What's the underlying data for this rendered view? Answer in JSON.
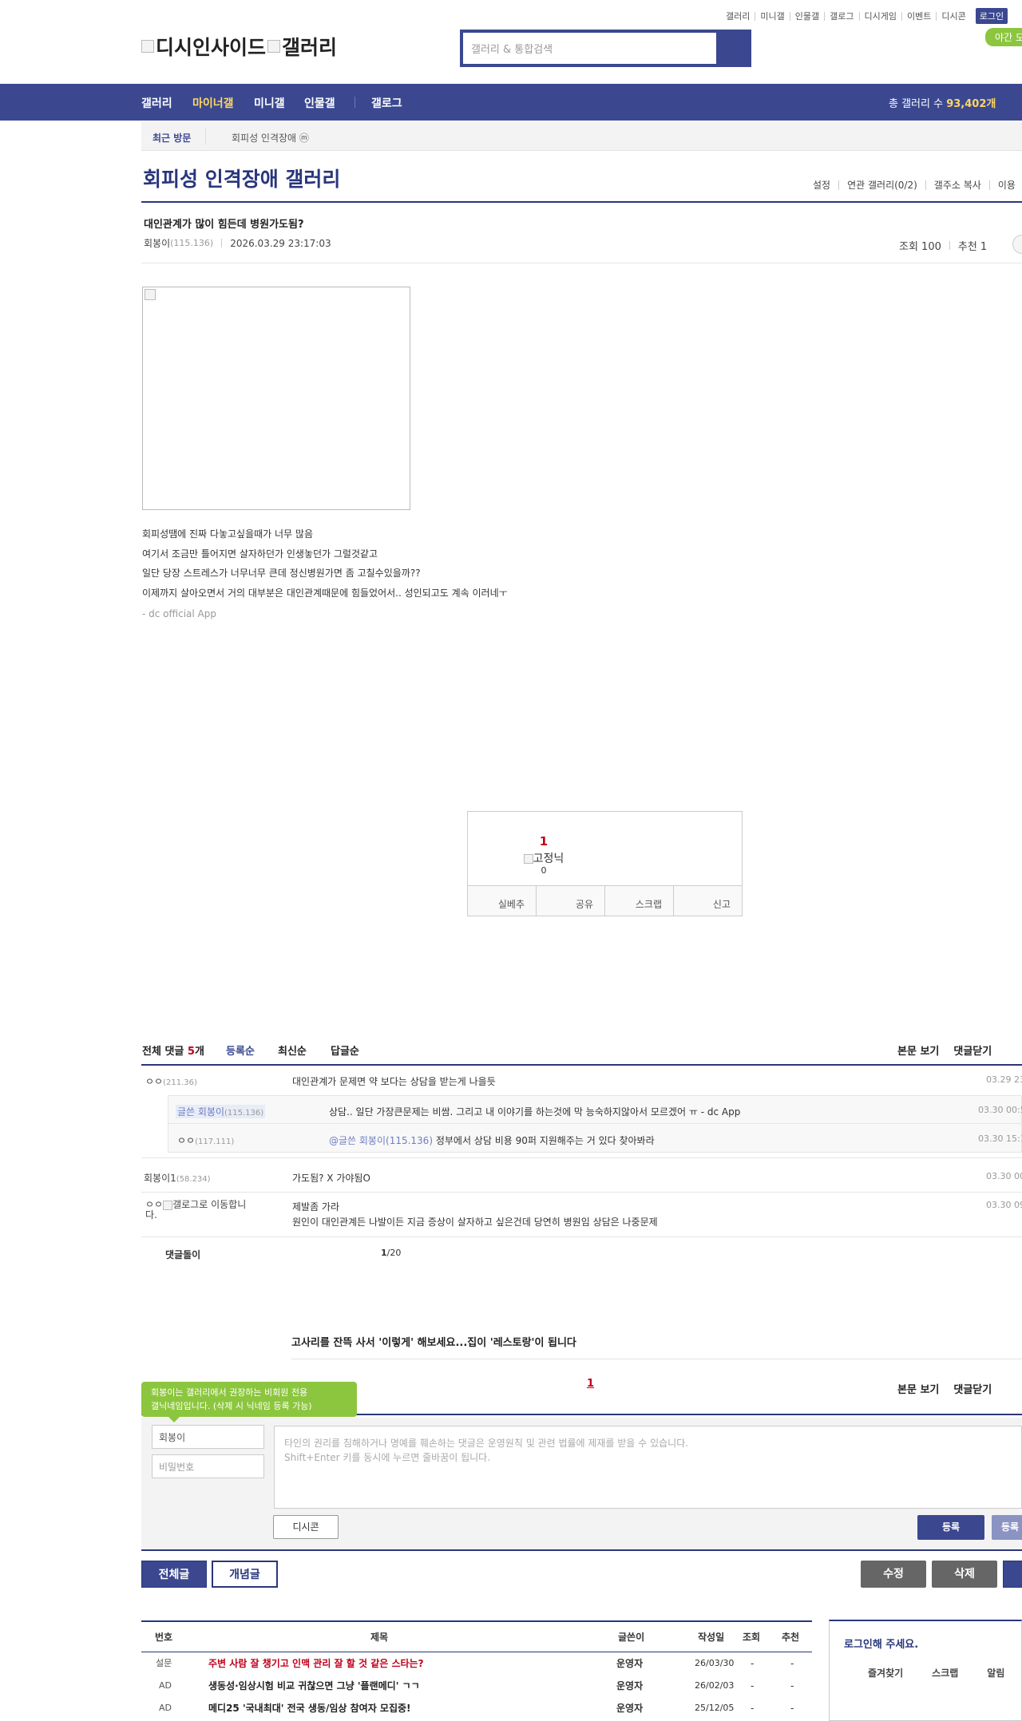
{
  "top_links": [
    "갤러리",
    "미니갤",
    "인물갤",
    "갤로그",
    "디시게임",
    "이벤트",
    "디시콘"
  ],
  "login_label": "로그인",
  "night_label": "야간 모",
  "logo": {
    "part1": "디시인사이드",
    "part2": "갤러리"
  },
  "search": {
    "placeholder": "갤러리 & 통합검색"
  },
  "nav": {
    "items": [
      "갤러리",
      "마이너갤",
      "미니갤",
      "인물갤",
      "갤로그"
    ],
    "total_label": "총 갤러리 수 ",
    "total_value": "93,402개"
  },
  "recent": {
    "label": "최근 방문",
    "item": "회피성 인격장애 ⓜ"
  },
  "gallery": {
    "title": "회피성 인격장애 갤러리",
    "tools": [
      "설정",
      "연관 갤러리(0/2)",
      "갤주소 복사",
      "이용"
    ]
  },
  "post": {
    "title": "대인관계가 많이 힘든데 병원가도됨?",
    "author": "회봉이",
    "author_ip": "(115.136)",
    "date": "2026.03.29 23:17:03",
    "views": "조회 100",
    "recommends": "추천 1",
    "body": [
      "회피성땜에 진짜 다놓고싶을때가 너무 많음",
      "여기서 조금만 틀어지면 살자하던가 인생놓던가 그럴것같고",
      "일단 당장 스트레스가 너무너무 큰데 정신병원가면 좀 고칠수있을까??",
      "이제까지 살아오면서 거의 대부분은 대인관계때문에 힘들었어서.. 성인되고도 계속 이러네ㅜ"
    ],
    "app_tag": "- dc official App"
  },
  "recommend": {
    "count": "1",
    "label": "고정닉",
    "fixed_count": "0",
    "buttons": [
      "실베추",
      "공유",
      "스크랩",
      "신고"
    ]
  },
  "comments_header": {
    "total_label": "전체 댓글 ",
    "total_count": "5",
    "total_unit": "개",
    "sort": [
      "등록순",
      "최신순",
      "답글순"
    ],
    "right": [
      "본문 보기",
      "댓글닫기"
    ]
  },
  "comments": [
    {
      "nick": "ㅇㅇ",
      "ip": "(211.36)",
      "text": "대인관계가 문제면 약 보다는 상담을 받는게 나을듯",
      "date": "03.29 23"
    },
    {
      "nick": "글쓴 회봉이",
      "ip": "(115.136)",
      "text": "상담.. 일단 가장큰문제는 비쌈. 그리고 내 이야기를 하는것에 막 능숙하지않아서 모르겠어 ㅠ - dc App",
      "date": "03.30 00:5"
    },
    {
      "nick": "ㅇㅇ",
      "ip": "(117.111)",
      "mention": "@글쓴 회봉이(115.136)",
      "text": " 정부에서 상담 비용 90퍼 지원해주는 거 있다 찾아봐라",
      "date": "03.30 15:1"
    },
    {
      "nick": "회봉이1",
      "ip": "(58.234)",
      "text": "가도됨? X 가야됨O",
      "date": "03.30 00"
    },
    {
      "nick": "ㅇㅇ",
      "img_alt": "갤로그로 이동합니다.",
      "text": "제발좀 가라",
      "text2": "원인이 대인관계든 나발이든 지금 증상이 살자하고 싶은건데 당연히 병원임 상담은 나중문제",
      "date": "03.30 09"
    }
  ],
  "comment_bot": {
    "label": "댓글돌이",
    "page": "1",
    "total": "/20"
  },
  "ad_title": "고사리를 잔뜩 사서 '이렇게' 해보세요...집이 '레스토랑'이 됩니다",
  "pagination": {
    "current": "1"
  },
  "write": {
    "tooltip_line1": "회봉이는 갤러리에서 권장하는 비회원 전용",
    "tooltip_line2": "갤닉네임입니다. (삭제 시 닉네임 등록 가능)",
    "nick_value": "회봉이",
    "pw_placeholder": "비밀번호",
    "textarea_line1": "타인의 권리를 침해하거나 명예를 훼손하는 댓글은 운영원칙 및 관련 법률에 제재를 받을 수 있습니다.",
    "textarea_line2": "Shift+Enter 키를 동시에 누르면 줄바꿈이 됩니다.",
    "dccon": "디시콘",
    "submit": "등록",
    "submit2": "등록"
  },
  "bottom_buttons": {
    "all": "전체글",
    "concept": "개념글",
    "edit": "수정",
    "delete": "삭제"
  },
  "table": {
    "headers": [
      "번호",
      "제목",
      "글쓴이",
      "작성일",
      "조회",
      "추천"
    ],
    "rows": [
      {
        "no": "설문",
        "title": "주변 사람 잘 챙기고 인맥 관리 잘 할 것 같은 스타는?",
        "writer": "운영자",
        "date": "26/03/30",
        "views": "-",
        "rec": "-",
        "hot": true
      },
      {
        "no": "AD",
        "title": "생동성·임상시험 비교 귀찮으면 그냥 '플랜메디' ㄱㄱ",
        "writer": "운영자",
        "date": "26/02/03",
        "views": "-",
        "rec": "-",
        "hot": false
      },
      {
        "no": "AD",
        "title": "메디25 '국내최대' 전국 생동/임상 참여자 모집중!",
        "writer": "운영자",
        "date": "25/12/05",
        "views": "-",
        "rec": "-",
        "hot": false
      }
    ]
  },
  "login_box": {
    "title": "로그인해 주세요.",
    "links": [
      "즐겨찾기",
      "스크랩",
      "알림"
    ]
  }
}
